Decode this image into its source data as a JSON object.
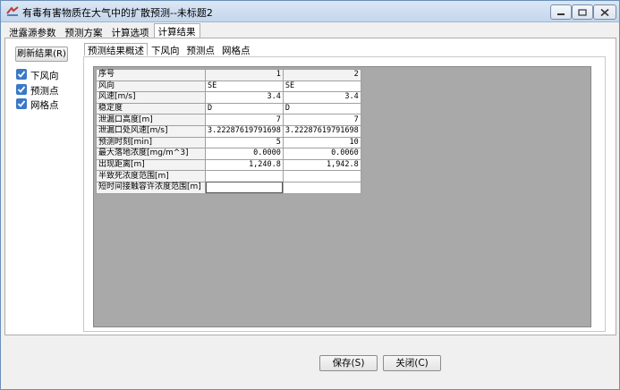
{
  "window": {
    "title": "有毒有害物质在大气中的扩散预测--未标题2"
  },
  "main_tabs": [
    {
      "label": "泄露源参数"
    },
    {
      "label": "预测方案"
    },
    {
      "label": "计算选项"
    },
    {
      "label": "计算结果"
    }
  ],
  "left": {
    "refresh_label": "刷新结果(R)",
    "checks": [
      {
        "label": "下风向",
        "checked": true
      },
      {
        "label": "预测点",
        "checked": true
      },
      {
        "label": "网格点",
        "checked": true
      }
    ]
  },
  "sub_tabs": [
    {
      "label": "预测结果概述"
    },
    {
      "label": "下风向"
    },
    {
      "label": "预测点"
    },
    {
      "label": "网格点"
    }
  ],
  "table": {
    "header": {
      "label": "序号",
      "col1": "1",
      "col2": "2"
    },
    "rows": [
      {
        "label": "风向",
        "v1": "SE",
        "v2": "SE"
      },
      {
        "label": "风速[m/s]",
        "v1": "3.4",
        "v2": "3.4"
      },
      {
        "label": "稳定度",
        "v1": "D",
        "v2": "D"
      },
      {
        "label": "泄漏口高度[m]",
        "v1": "7",
        "v2": "7"
      },
      {
        "label": "泄漏口处风速[m/s]",
        "v1": "3.22287619791698",
        "v2": "3.22287619791698"
      },
      {
        "label": "预测时刻[min]",
        "v1": "5",
        "v2": "10"
      },
      {
        "label": "最大落地浓度[mg/m^3]",
        "v1": "0.0000",
        "v2": "0.0060"
      },
      {
        "label": "出现距离[m]",
        "v1": "1,240.8",
        "v2": "1,942.8"
      },
      {
        "label": "半致死浓度范围[m]",
        "v1": "",
        "v2": ""
      },
      {
        "label": "短时间接触容许浓度范围[m]",
        "v1": "",
        "v2": ""
      }
    ]
  },
  "buttons": {
    "save": "保存(S)",
    "close": "关闭(C)"
  }
}
